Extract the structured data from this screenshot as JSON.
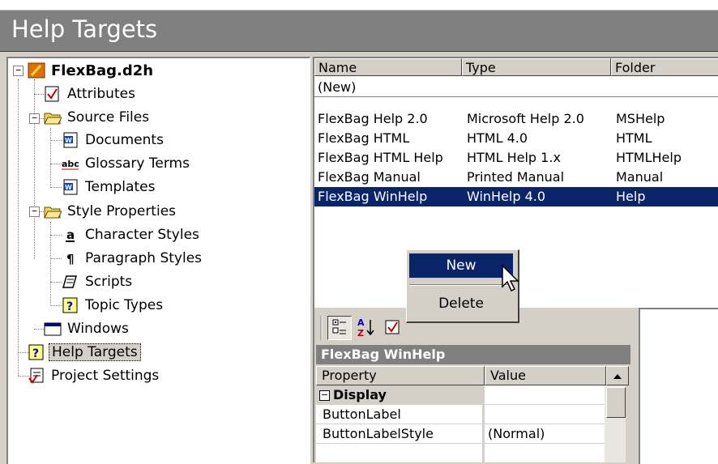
{
  "window": {
    "title": "Help Targets"
  },
  "tree": {
    "root": "FlexBag.d2h",
    "attributes": "Attributes",
    "source_files": "Source Files",
    "documents": "Documents",
    "glossary_terms": "Glossary Terms",
    "templates": "Templates",
    "style_properties": "Style Properties",
    "character_styles": "Character Styles",
    "paragraph_styles": "Paragraph Styles",
    "scripts": "Scripts",
    "topic_types": "Topic Types",
    "windows": "Windows",
    "help_targets": "Help Targets",
    "project_settings": "Project Settings",
    "toggle_minus": "−"
  },
  "list": {
    "columns": [
      "Name",
      "Type",
      "Folder"
    ],
    "new_row": "(New)",
    "rows": [
      {
        "name": "FlexBag Help 2.0",
        "type": "Microsoft Help 2.0",
        "folder": "MSHelp"
      },
      {
        "name": "FlexBag HTML",
        "type": "HTML 4.0",
        "folder": "HTML"
      },
      {
        "name": "FlexBag HTML Help",
        "type": "HTML Help 1.x",
        "folder": "HTMLHelp"
      },
      {
        "name": "FlexBag Manual",
        "type": "Printed Manual",
        "folder": "Manual"
      },
      {
        "name": "FlexBag WinHelp",
        "type": "WinHelp 4.0",
        "folder": "Help"
      }
    ]
  },
  "context_menu": {
    "new": "New",
    "delete": "Delete"
  },
  "properties": {
    "object": "FlexBag WinHelp",
    "col_property": "Property",
    "col_value": "Value",
    "category": "Display",
    "category_toggle": "−",
    "rows": [
      {
        "name": "ButtonLabel",
        "value": ""
      },
      {
        "name": "ButtonLabelStyle",
        "value": "(Normal)"
      }
    ]
  },
  "colors": {
    "selection": "#0a246a",
    "title_bar": "#808080",
    "face": "#d4d0c8"
  }
}
